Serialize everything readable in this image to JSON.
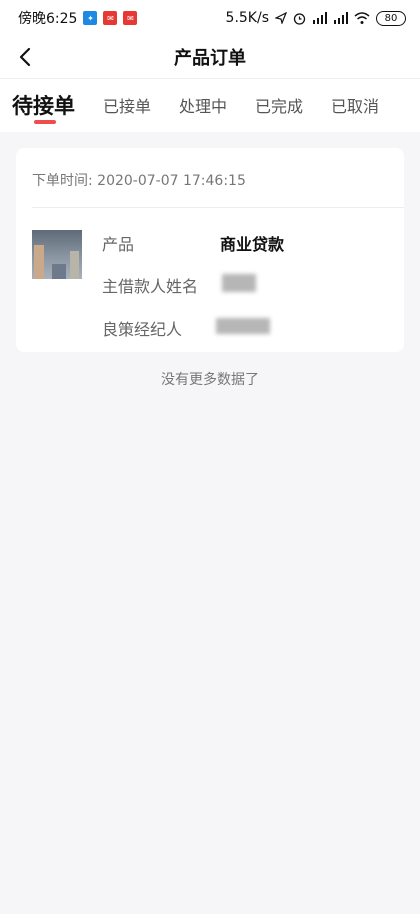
{
  "status_bar": {
    "time": "傍晚6:25",
    "net_speed": "5.5K/s",
    "battery": "80",
    "app_badges": [
      "app-icon-blue",
      "app-icon-red",
      "app-icon-red"
    ],
    "icons": [
      "send-icon",
      "alarm-icon",
      "signal-icon",
      "signal-icon",
      "wifi-icon"
    ]
  },
  "nav": {
    "title": "产品订单",
    "back_icon": "back-chevron-icon"
  },
  "tabs": [
    {
      "label": "待接单",
      "active": true
    },
    {
      "label": "已接单",
      "active": false
    },
    {
      "label": "处理中",
      "active": false
    },
    {
      "label": "已完成",
      "active": false
    },
    {
      "label": "已取消",
      "active": false
    }
  ],
  "order": {
    "time_label": "下单时间:",
    "time_value": "2020-07-07 17:46:15",
    "thumbnail": "product-thumbnail",
    "rows": [
      {
        "label": "产品",
        "value": "商业贷款"
      },
      {
        "label": "主借款人姓名",
        "value": ""
      },
      {
        "label": "良策经纪人",
        "value": ""
      }
    ]
  },
  "footer": {
    "no_more": "没有更多数据了"
  },
  "colors": {
    "accent": "#ee4d4d",
    "background": "#f6f6f8",
    "card": "#ffffff"
  }
}
